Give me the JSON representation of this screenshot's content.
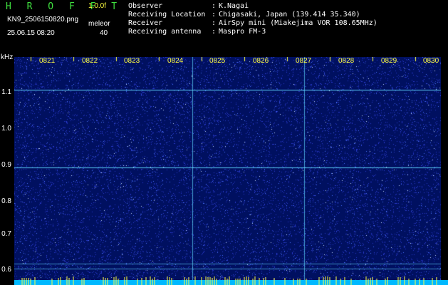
{
  "header": {
    "app_title": "H R O F F T",
    "version": "1.0.0f",
    "filename": "KN9_2506150820.png",
    "timestamp": "25.06.15 08:20",
    "mode_label": "meleor",
    "mode_value": "40"
  },
  "meta": [
    {
      "label": "Observer",
      "value": "K.Nagai"
    },
    {
      "label": "Receiving Location",
      "value": "Chigasaki, Japan (139.414 35.340)"
    },
    {
      "label": "Receiver",
      "value": "AirSpy mini (Miakejima VOR 108.65MHz)"
    },
    {
      "label": "Receiving antenna",
      "value": "Maspro FM-3"
    }
  ],
  "spectrogram": {
    "unit_label": "kHz",
    "freq_labels": [
      "1.1",
      "1.0",
      "0.9",
      "0.8",
      "0.7",
      "0.6"
    ],
    "time_labels": [
      "0821",
      "0822",
      "0823",
      "0824",
      "0825",
      "0826",
      "0827",
      "0828",
      "0829",
      "0830"
    ],
    "colors": {
      "background": "#001060",
      "noise": "#3050ff",
      "signal": "#60d8ff",
      "marker": "#ffff40"
    }
  }
}
